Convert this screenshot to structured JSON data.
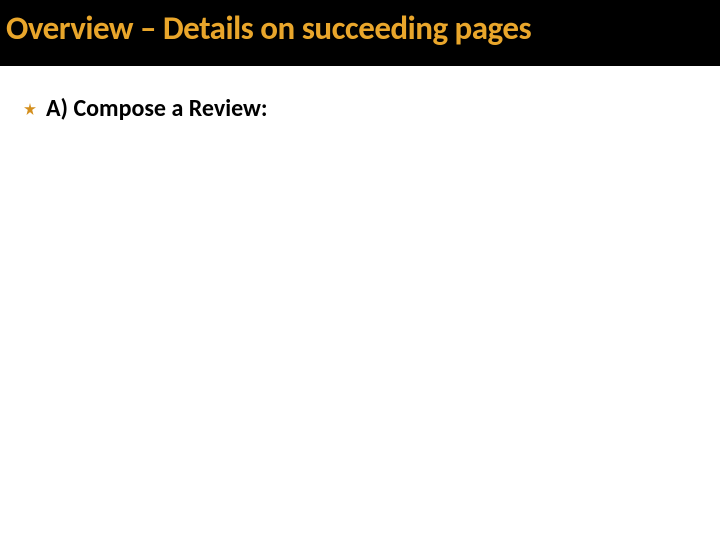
{
  "slide": {
    "title": "Overview – Details on succeeding pages",
    "bullets": [
      {
        "text": "A)  Compose a Review:"
      }
    ],
    "colors": {
      "title_bg": "#000000",
      "title_fg": "#e9a62b",
      "bullet_icon": "#d48f1d"
    }
  }
}
